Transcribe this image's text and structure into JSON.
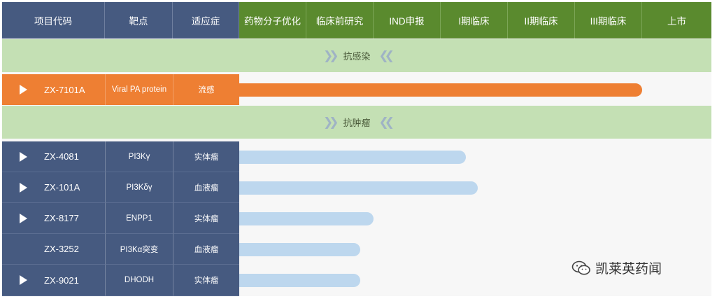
{
  "header": {
    "columns": [
      "项目代码",
      "靶点",
      "适应症"
    ],
    "stages": [
      "药物分子优化",
      "临床前研究",
      "IND申报",
      "I期临床",
      "II期临床",
      "III期临床",
      "上市"
    ]
  },
  "categories": [
    {
      "name": "抗感染"
    },
    {
      "name": "抗肿瘤"
    }
  ],
  "rows": [
    {
      "code": "ZX-7101A",
      "target": "Viral PA protein",
      "indication": "流感",
      "progress_stage": 6.0,
      "has_play": true,
      "color": "#ee7f33"
    },
    {
      "code": "ZX-4081",
      "target": "PI3Kγ",
      "indication": "实体瘤",
      "progress_stage": 3.38,
      "has_play": true,
      "color": "#bdd7ee"
    },
    {
      "code": "ZX-101A",
      "target": "PI3Kδγ",
      "indication": "血液瘤",
      "progress_stage": 3.55,
      "has_play": true,
      "color": "#bdd7ee"
    },
    {
      "code": "ZX-8177",
      "target": "ENPP1",
      "indication": "实体瘤",
      "progress_stage": 2.0,
      "has_play": true,
      "color": "#bdd7ee"
    },
    {
      "code": "ZX-3252",
      "target": "PI3Kα突变",
      "indication": "血液瘤",
      "progress_stage": 1.8,
      "has_play": false,
      "color": "#bdd7ee"
    },
    {
      "code": "ZX-9021",
      "target": "DHODH",
      "indication": "实体瘤",
      "progress_stage": 1.8,
      "has_play": true,
      "color": "#bdd7ee"
    }
  ],
  "watermark": {
    "text": "凯莱英药闻",
    "icon": "wechat-icon"
  },
  "colors": {
    "header_blue": "#465a80",
    "header_green": "#5a8a2e",
    "band": "#c4e0b4",
    "orange": "#ee7f33",
    "light_bar": "#bdd7ee"
  }
}
